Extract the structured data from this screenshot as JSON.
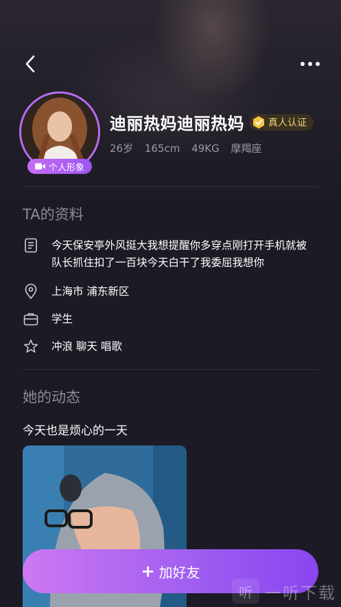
{
  "profile": {
    "name": "迪丽热妈迪丽热妈",
    "verified_label": "真人认证",
    "video_badge_label": "个人形象",
    "age": "26岁",
    "height": "165cm",
    "weight": "49KG",
    "zodiac": "摩羯座"
  },
  "info": {
    "title": "TA的资料",
    "bio_line1": "今天保安亭外风挺大我想提醒你多穿点刚打开手机就被",
    "bio_line2": "队长抓住扣了一百块今天白干了我委屈我想你",
    "location": "上海市 浦东新区",
    "occupation": "学生",
    "hobbies": "冲浪 聊天 唱歌"
  },
  "feed": {
    "title": "她的动态",
    "post_text": "今天也是烦心的一天"
  },
  "actions": {
    "add_friend_label": "加好友",
    "add_friend_plus": "+"
  },
  "watermark": {
    "logo": "听",
    "text": "一听下载"
  },
  "colors": {
    "background": "#1c1a24",
    "accent_purple": "#b56ef5",
    "verified_gold": "#f4cf74",
    "muted_text": "#9a98a3"
  }
}
